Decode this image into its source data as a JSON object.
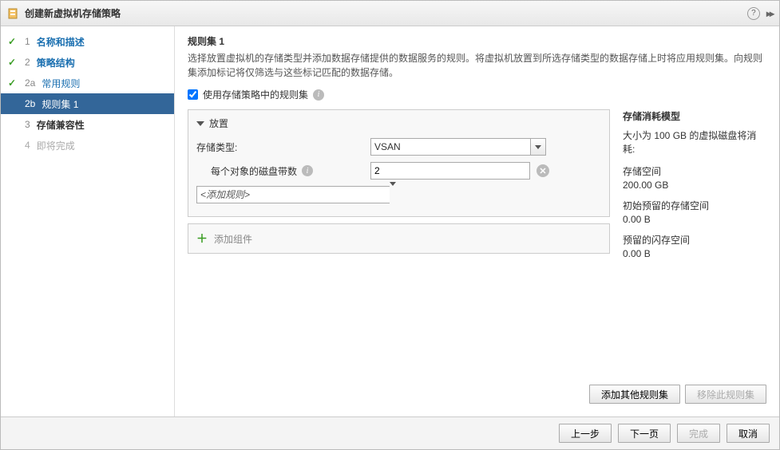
{
  "titlebar": {
    "title": "创建新虚拟机存储策略"
  },
  "steps": {
    "s1": {
      "num": "1",
      "label": "名称和描述"
    },
    "s2": {
      "num": "2",
      "label": "策略结构"
    },
    "s2a": {
      "num": "2a",
      "label": "常用规则"
    },
    "s2b": {
      "num": "2b",
      "label": "规则集 1"
    },
    "s3": {
      "num": "3",
      "label": "存储兼容性"
    },
    "s4": {
      "num": "4",
      "label": "即将完成"
    }
  },
  "content": {
    "heading": "规则集 1",
    "description": "选择放置虚拟机的存储类型并添加数据存储提供的数据服务的规则。将虚拟机放置到所选存储类型的数据存储上时将应用规则集。向规则集添加标记将仅筛选与这些标记匹配的数据存储。",
    "checkbox_label": "使用存储策略中的规则集",
    "placement": {
      "header": "放置",
      "storage_type_label": "存储类型:",
      "storage_type_value": "VSAN",
      "stripe_label": "每个对象的磁盘带数",
      "stripe_value": "2",
      "add_rule_placeholder": "<添加规则>"
    },
    "add_component": "添加组件",
    "consumption": {
      "title": "存储消耗模型",
      "desc": "大小为 100 GB 的虚拟磁盘将消耗:",
      "storage_space_label": "存储空间",
      "storage_space_value": "200.00 GB",
      "reserved_label": "初始预留的存储空间",
      "reserved_value": "0.00 B",
      "flash_label": "预留的闪存空间",
      "flash_value": "0.00 B"
    },
    "ruleset_buttons": {
      "add": "添加其他规则集",
      "remove": "移除此规则集"
    }
  },
  "footer": {
    "back": "上一步",
    "next": "下一页",
    "finish": "完成",
    "cancel": "取消"
  }
}
